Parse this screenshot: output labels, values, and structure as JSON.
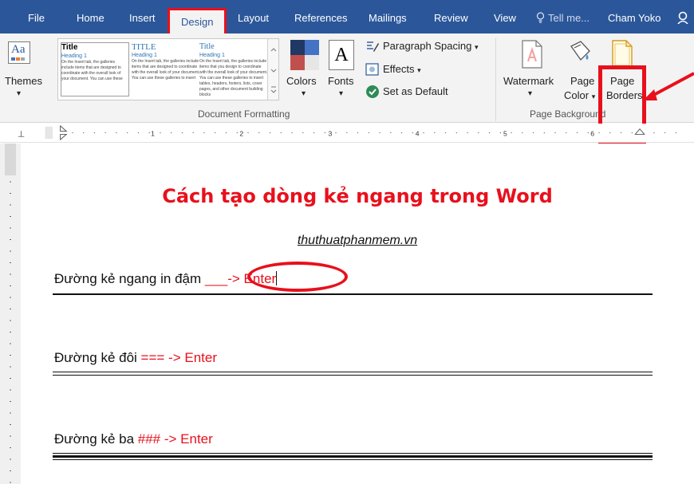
{
  "tabs": {
    "file": "File",
    "home": "Home",
    "insert": "Insert",
    "design": "Design",
    "layout": "Layout",
    "references": "References",
    "mailings": "Mailings",
    "review": "Review",
    "view": "View",
    "tell_me": "Tell me...",
    "user": "Cham Yoko"
  },
  "ribbon": {
    "themes_label": "Themes",
    "gallery": [
      {
        "title": "Title",
        "heading": "Heading 1",
        "body": "On the Insert tab, the galleries include items that are designed to coordinate with the overall look of your document. You can use these"
      },
      {
        "title": "TITLE",
        "heading": "Heading 1",
        "body": "On the Insert tab, the galleries include items that are designed to coordinate with the overall look of your document. You can use these galleries to insert"
      },
      {
        "title": "Title",
        "heading": "Heading 1",
        "body": "On the Insert tab, the galleries include items that you design to coordinate with the overall look of your document. You can use these galleries to insert tables, headers, footers, lists, cover pages, and other document building blocks"
      }
    ],
    "colors_label": "Colors",
    "fonts_label": "Fonts",
    "fonts_glyph": "A",
    "paragraph_spacing": "Paragraph Spacing",
    "effects": "Effects",
    "set_default": "Set as Default",
    "document_formatting": "Document Formatting",
    "watermark": "Watermark",
    "page_color_line1": "Page",
    "page_color_line2": "Color",
    "page_borders_line1": "Page",
    "page_borders_line2": "Borders",
    "page_background": "Page Background",
    "dropdown_glyph": "▾",
    "theme_colors": [
      "#203864",
      "#4472c4",
      "#c0504d",
      "#e7e6e6"
    ]
  },
  "ruler": {
    "marks": [
      "1",
      "2",
      "3",
      "4",
      "5",
      "6"
    ]
  },
  "document": {
    "title": "Cách tạo dòng kẻ ngang trong Word",
    "site": "thuthuatphanmem.vn",
    "lines": [
      {
        "text": "Đường kẻ ngang in đậm ",
        "code": "___",
        "enter": "-> Enter"
      },
      {
        "text": "Đường kẻ đôi ",
        "code": "===",
        "enter": " -> Enter"
      },
      {
        "text": "Đường kẻ ba ",
        "code": "###",
        "enter": " -> Enter"
      }
    ]
  },
  "colors": {
    "accent": "#2b579a",
    "highlight": "#e8101c"
  }
}
